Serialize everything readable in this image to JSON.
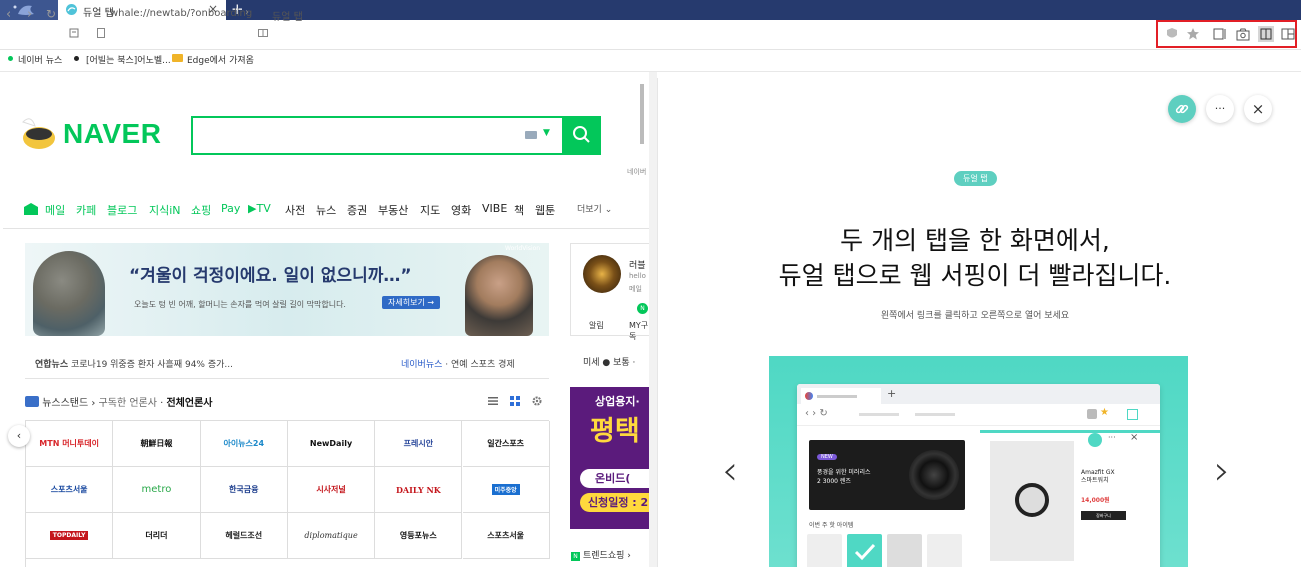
{
  "browser": {
    "tab_title": "듀얼 탭",
    "tab_close": "×",
    "new_tab": "+",
    "url": "whale://newtab/?onboarding",
    "breadcrumb": "듀얼 탭",
    "nav": {
      "back": "‹",
      "forward": "›",
      "reload": "↻",
      "home": "⌂"
    }
  },
  "toolbar_icons": [
    "shield-icon",
    "star-icon",
    "sidebar-icon",
    "camera-icon",
    "dual-tab-icon",
    "split-view-icon"
  ],
  "bookmarks": [
    "네이버 뉴스",
    "[어빌는 북스]어노벨...",
    "Edge에서 가져옴"
  ],
  "naver": {
    "logo": "NAVER",
    "menu": [
      "메일",
      "카페",
      "블로그",
      "지식iN",
      "쇼핑",
      "Pay",
      "TV",
      "사전",
      "뉴스",
      "증권",
      "부동산",
      "지도",
      "영화",
      "VIBE",
      "책",
      "웹툰"
    ],
    "more": "더보기",
    "banner_quote": "“겨울이 걱정이에요. 일이 없으니까…”",
    "banner_sub": "오늘도 텅 빈 어깨, 할머니는 손자를 먹여 살릴 길이 막막합니다.",
    "banner_cta": "자세히보기 →",
    "banner_wm": "WorldVision",
    "news_label": "연합뉴스",
    "news_headline": "코로나19 위중증 환자 사흘째 94% 증가...",
    "news_links": [
      "네이버뉴스",
      "연예",
      "스포츠",
      "경제"
    ],
    "newsstand_title": "뉴스스탠드",
    "newsstand_sub": "구독한 언론사",
    "newsstand_all": "전체언론사",
    "press": [
      "MTN 머니투데이",
      "朝鮮日報",
      "아이뉴스24",
      "NewDaily",
      "프레시안",
      "일간스포츠",
      "스포츠서울",
      "metro",
      "한국금융",
      "시사저널",
      "DAILY NK",
      "미주중앙",
      "TOPDAILY",
      "더리더",
      "헤럴드조선",
      "diplomatique",
      "영등포뉴스",
      "스포츠서울"
    ],
    "profile_name": "러블",
    "profile_line1": "hello",
    "profile_line2": "메일",
    "profile_badge": "N",
    "profile_mail": "알림",
    "profile_my": "MY구독",
    "weather_text": "미세 ● 보통 ·",
    "ad_t1": "상업용지·",
    "ad_t2": "평택",
    "ad_t3": "온비드(",
    "ad_t4": "신청일정 : 2",
    "trend": "트렌드쇼핑",
    "side_label": "네이버",
    "left_arrow": "‹"
  },
  "dual_tab": {
    "badge": "듀얼 탭",
    "heading_line1": "두 개의 탭을 한 화면에서,",
    "heading_line2": "듀얼 탭으로 웹 서핑이 더 빨라집니다.",
    "desc": "왼쪽에서 링크를 클릭하고 오른쪽으로 열어 보세요",
    "more_btn": "···",
    "close_btn": "×",
    "prev": "‹",
    "next": "›",
    "mock_card_pill": "NEW",
    "mock_card_text": "풍경을 위한 미러리스\n2 3000 렌즈",
    "mock_caption": "이번 주 핫 아이템",
    "watch_text": "Amazfit GX\n스마트워치",
    "watch_price": "14,000원",
    "watch_btn": "장바구니"
  },
  "colors": {
    "naver_green": "#03c75a",
    "whale_navy": "#263a6e",
    "mint": "#5ecfc0",
    "highlight_red": "#e21f26"
  }
}
